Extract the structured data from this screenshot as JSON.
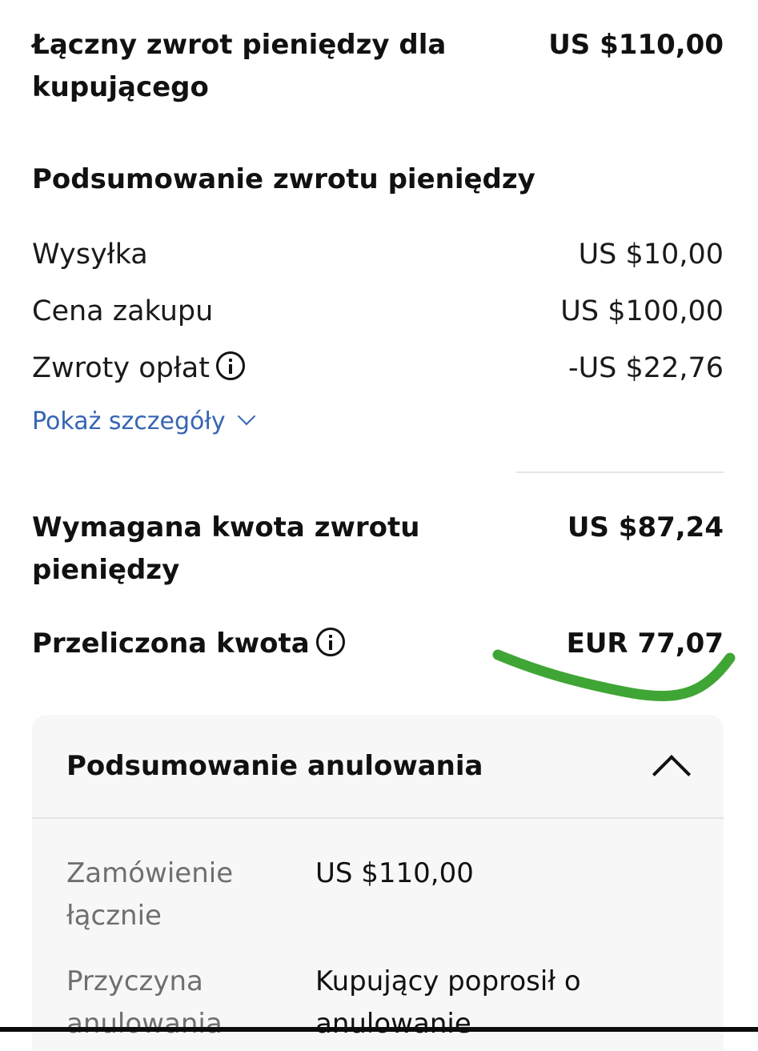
{
  "total_refund": {
    "label": "Łączny zwrot pieniędzy dla kupującego",
    "value": "US $110,00"
  },
  "summary_title": "Podsumowanie zwrotu pieniędzy",
  "lines": [
    {
      "label": "Wysyłka",
      "value": "US $10,00"
    },
    {
      "label": "Cena zakupu",
      "value": "US $100,00"
    },
    {
      "label": "Zwroty opłat",
      "value": "-US $22,76"
    }
  ],
  "details_link": "Pokaż szczegóły",
  "required": {
    "label": "Wymagana kwota zwrotu pieniędzy",
    "value": "US $87,24"
  },
  "converted": {
    "label": "Przeliczona kwota",
    "value": "EUR 77,07"
  },
  "cancel_card": {
    "title": "Podsumowanie anulowania",
    "rows": [
      {
        "label": "Zamówienie łącznie",
        "value": "US $110,00"
      },
      {
        "label": "Przyczyna anulowania",
        "value": "Kupujący poprosił o anulowanie"
      }
    ]
  },
  "colors": {
    "link": "#3665b3",
    "highlight": "#3fa535",
    "card_bg": "#f7f7f7"
  },
  "icons": [
    "info-icon",
    "chevron-down-icon",
    "chevron-up-icon"
  ]
}
